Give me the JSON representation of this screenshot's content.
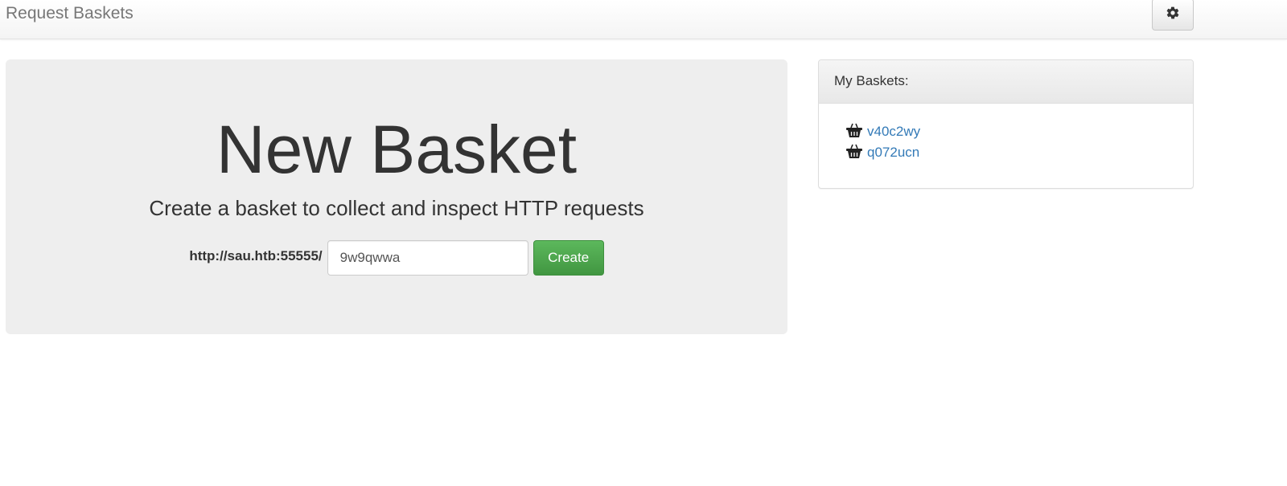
{
  "navbar": {
    "brand": "Request Baskets",
    "settings_icon": "gear-icon"
  },
  "jumbotron": {
    "title": "New Basket",
    "subtitle": "Create a basket to collect and inspect HTTP requests",
    "url_prefix": "http://sau.htb:55555/",
    "basket_name_value": "9w9qwwa",
    "create_label": "Create"
  },
  "baskets_panel": {
    "heading": "My Baskets:",
    "item_icon": "basket-icon",
    "items": [
      {
        "name": "v40c2wy"
      },
      {
        "name": "q072ucn"
      }
    ]
  },
  "colors": {
    "create_button": "#4cae4c",
    "link": "#337ab7",
    "jumbotron_bg": "#eeeeee"
  }
}
